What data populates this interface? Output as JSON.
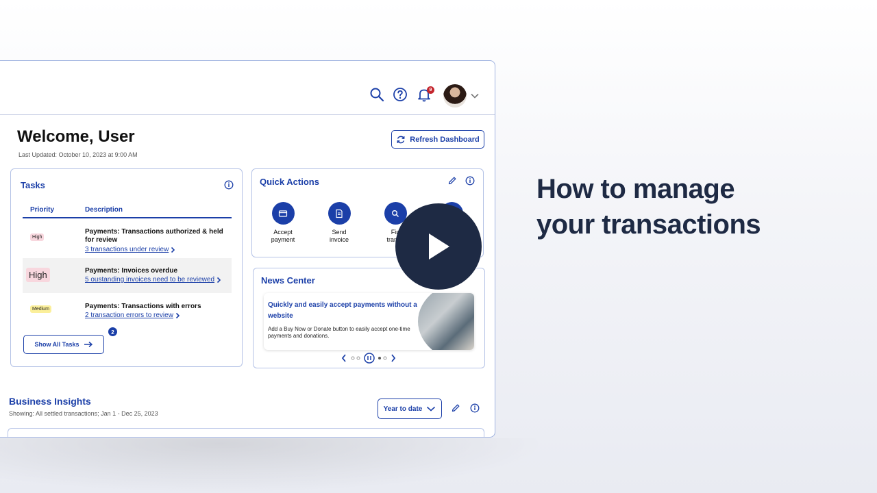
{
  "topbar": {
    "notification_count": "9",
    "icons": [
      "search-icon",
      "help-icon",
      "bell-icon",
      "avatar",
      "chevron-down-icon"
    ]
  },
  "header": {
    "welcome": "Welcome, User",
    "last_updated": "Last Updated: October 10, 2023 at 9:00 AM",
    "refresh_label": "Refresh Dashboard"
  },
  "tasks": {
    "title": "Tasks",
    "col_priority": "Priority",
    "col_description": "Description",
    "rows": [
      {
        "priority": "High",
        "title": "Payments: Transactions authorized & held for review",
        "link": "3 transactions under review"
      },
      {
        "priority": "High",
        "title": "Payments: Invoices overdue",
        "link": "5 oustanding invoices need to be reviewed"
      },
      {
        "priority": "Medium",
        "title": "Payments: Transactions with errors",
        "link": "2 transaction errors to review"
      }
    ],
    "show_all_label": "Show All Tasks",
    "show_all_count": "2"
  },
  "quick_actions": {
    "title": "Quick Actions",
    "items": [
      {
        "label_line1": "Accept",
        "label_line2": "payment",
        "icon": "card-icon"
      },
      {
        "label_line1": "Send",
        "label_line2": "invoice",
        "icon": "invoice-icon"
      },
      {
        "label_line1": "Fin",
        "label_line2": "transa",
        "icon": "search-icon"
      }
    ]
  },
  "news": {
    "title": "News Center",
    "headline": "Quickly and easily accept payments without a website",
    "body": "Add a Buy Now or Donate button to easily accept one-time payments and donations."
  },
  "insights": {
    "title": "Business Insights",
    "showing": "Showing: All settled transactions; Jan 1 - Dec 25, 2023",
    "range_label": "Year to date"
  },
  "hero": {
    "line1": "How to manage",
    "line2": "your transactions"
  },
  "colors": {
    "accent": "#1b3fa8",
    "play_button": "#1e2a44",
    "badge_high": "#f8d7de",
    "badge_medium": "#fbef9a",
    "notification": "#c4262e"
  }
}
